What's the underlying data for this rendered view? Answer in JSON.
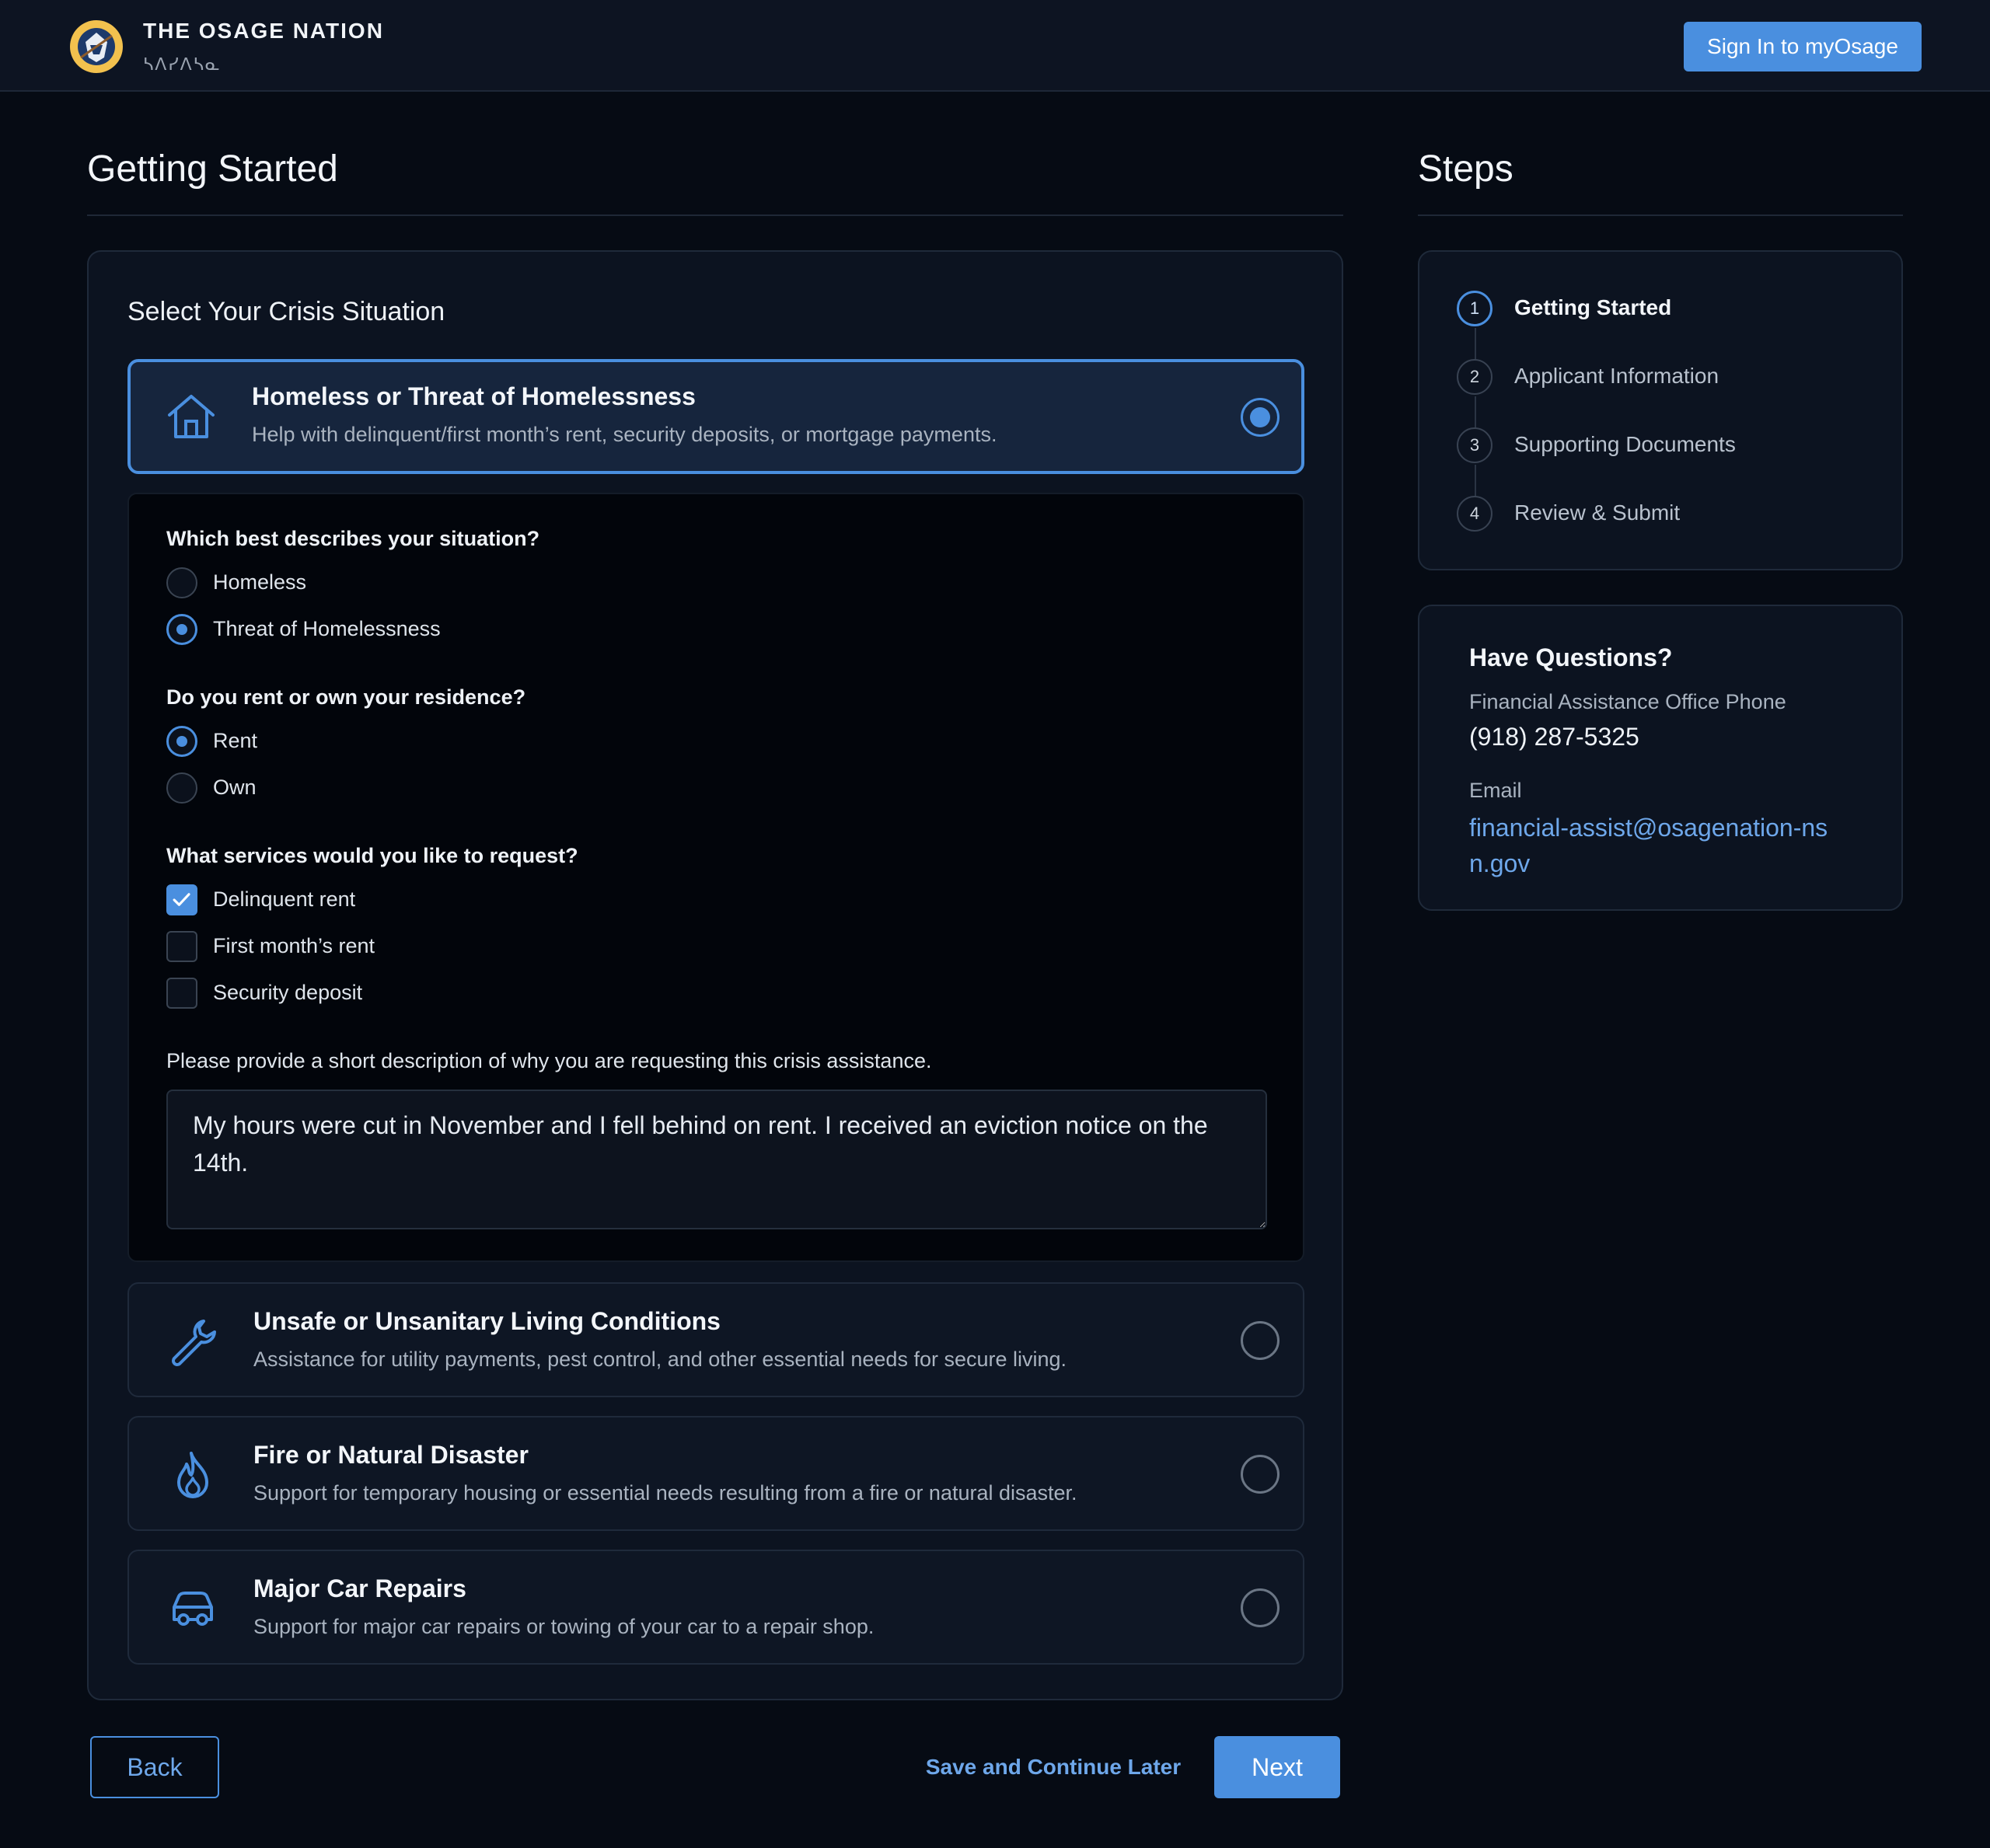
{
  "header": {
    "org_name": "THE OSAGE NATION",
    "org_subtitle": "ᓴᐱᓯᐱᓴᓇ",
    "sign_in_label": "Sign In to myOsage"
  },
  "main": {
    "title": "Getting Started",
    "section_title": "Select Your Crisis Situation",
    "options": [
      {
        "title": "Homeless or Threat of Homelessness",
        "desc": "Help with delinquent/first month’s rent, security deposits, or mortgage payments.",
        "selected": true,
        "icon": "house-icon"
      },
      {
        "title": "Unsafe or Unsanitary Living Conditions",
        "desc": "Assistance for utility payments, pest control, and other essential needs for secure living.",
        "selected": false,
        "icon": "wrench-icon"
      },
      {
        "title": "Fire or Natural Disaster",
        "desc": "Support for temporary housing or essential needs resulting from a fire or natural disaster.",
        "selected": false,
        "icon": "flame-icon"
      },
      {
        "title": "Major Car Repairs",
        "desc": "Support for major car repairs or towing of your car to a repair shop.",
        "selected": false,
        "icon": "car-icon"
      }
    ],
    "questions": {
      "situation": {
        "label": "Which best describes your situation?",
        "options": [
          "Homeless",
          "Threat of Homelessness"
        ],
        "selected": "Threat of Homelessness"
      },
      "residence": {
        "label": "Do you rent or own your residence?",
        "options": [
          "Rent",
          "Own"
        ],
        "selected": "Rent"
      },
      "services": {
        "label": "What services would you like to request?",
        "options": [
          "Delinquent rent",
          "First month’s rent",
          "Security deposit"
        ],
        "checked": [
          "Delinquent rent"
        ]
      },
      "description": {
        "label": "Please provide a short description of why you are requesting this crisis assistance.",
        "value": "My hours were cut in November and I fell behind on rent. I received an eviction notice on the 14th."
      }
    },
    "buttons": {
      "back": "Back",
      "save": "Save and Continue Later",
      "next": "Next"
    }
  },
  "sidebar": {
    "steps_title": "Steps",
    "steps": [
      {
        "num": "1",
        "name": "Getting Started",
        "active": true
      },
      {
        "num": "2",
        "name": "Applicant Information",
        "active": false
      },
      {
        "num": "3",
        "name": "Supporting Documents",
        "active": false
      },
      {
        "num": "4",
        "name": "Review & Submit",
        "active": false
      }
    ],
    "questions": {
      "title": "Have Questions?",
      "phone_label": "Financial Assistance Office Phone",
      "phone": "(918) 287-5325",
      "email_label": "Email",
      "email": "financial-assist@osagenation-nsn.gov"
    }
  },
  "colors": {
    "accent": "#4a8fdf",
    "background": "#060b14",
    "panel": "#0c1320",
    "logo_gold": "#f2c14e"
  }
}
